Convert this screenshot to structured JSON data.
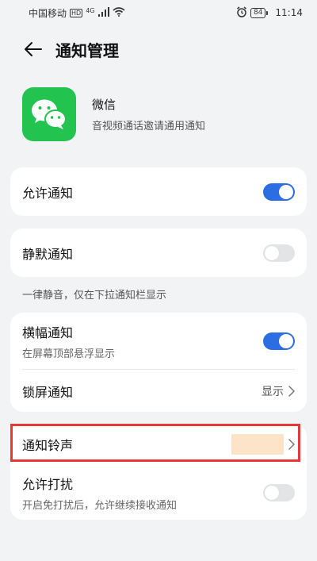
{
  "status_bar": {
    "carrier": "中国移动",
    "hd": "HD",
    "network": "4G",
    "battery": "84",
    "time": "11:14"
  },
  "header": {
    "title": "通知管理"
  },
  "app": {
    "name": "微信",
    "description": "音视频通话邀请通用通知"
  },
  "settings": {
    "allow_notifications": {
      "label": "允许通知",
      "enabled": true
    },
    "silent_notifications": {
      "label": "静默通知",
      "enabled": false
    },
    "silent_note": "一律静音，仅在下拉通知栏显示",
    "banner_notifications": {
      "label": "横幅通知",
      "sub": "在屏幕顶部悬浮显示",
      "enabled": true
    },
    "lock_screen_notifications": {
      "label": "锁屏通知",
      "value": "显示"
    },
    "notification_ringtone": {
      "label": "通知铃声"
    },
    "allow_disturb": {
      "label": "允许打扰",
      "sub": "开启免打扰后，允许继续接收通知",
      "enabled": false
    }
  },
  "colors": {
    "toggle_on": "#2b6de3",
    "toggle_off": "#e3e4e6",
    "wechat_green": "#22c34e",
    "highlight": "#e53935"
  }
}
